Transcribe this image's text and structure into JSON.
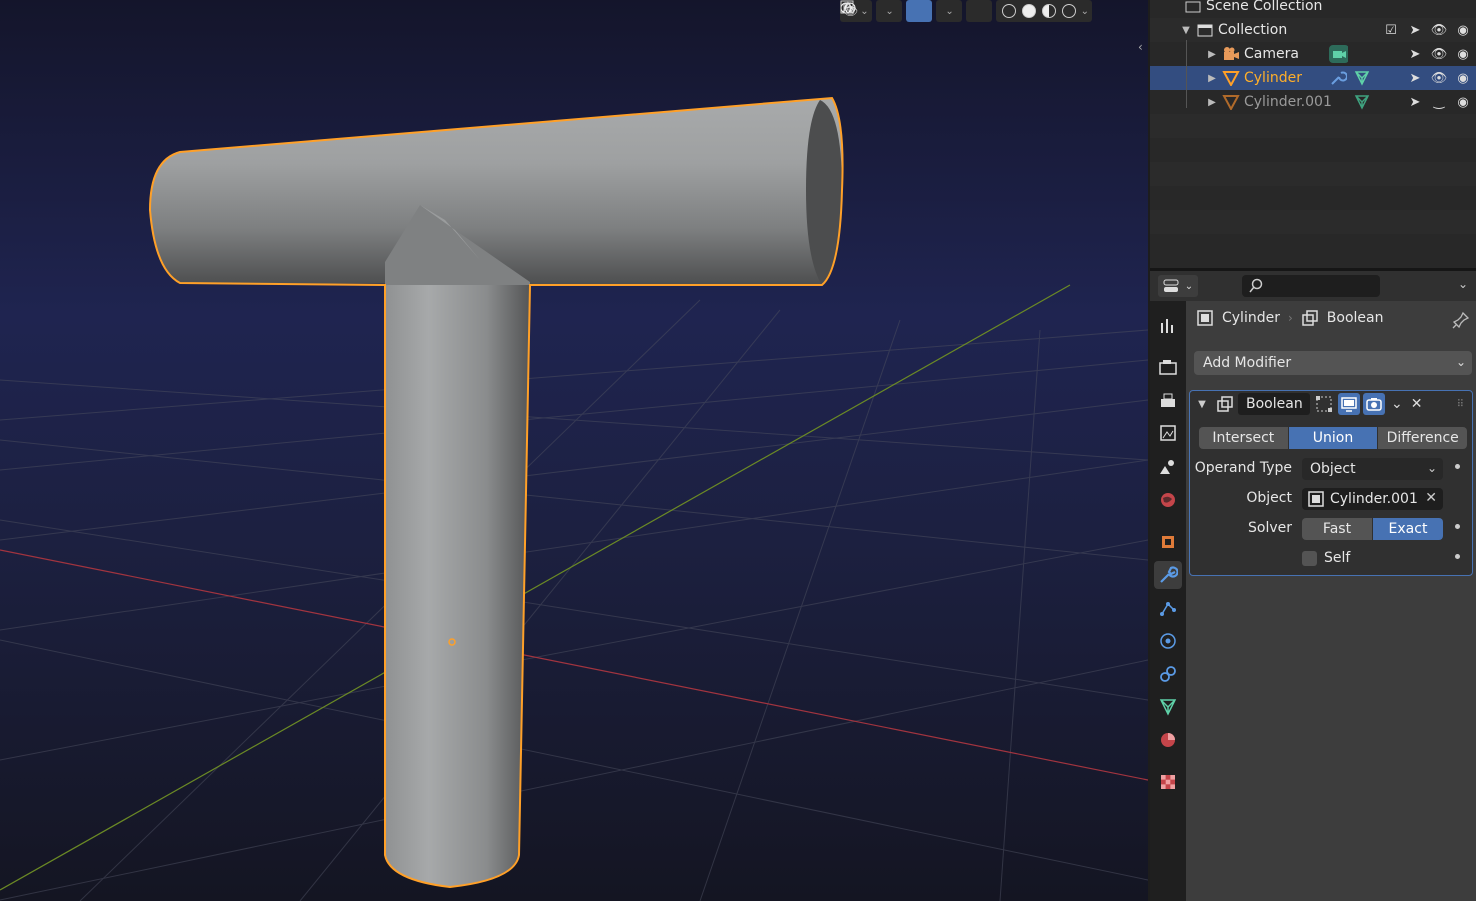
{
  "viewport": {
    "header_icons": [
      "view-object-types-icon",
      "gizmo-icon",
      "overlays-icon",
      "xray-icon",
      "wireframe-shading-icon",
      "solid-shading-icon",
      "material-shading-icon",
      "rendered-shading-icon"
    ]
  },
  "outliner": {
    "rows": [
      {
        "label": "Scene Collection"
      },
      {
        "label": "Collection"
      },
      {
        "label": "Camera"
      },
      {
        "label": "Cylinder"
      },
      {
        "label": "Cylinder.001"
      }
    ]
  },
  "properties": {
    "search_placeholder": "",
    "breadcrumb": {
      "object": "Cylinder",
      "modifier": "Boolean"
    },
    "add_modifier": "Add Modifier",
    "modifier": {
      "name": "Boolean",
      "operations": [
        "Intersect",
        "Union",
        "Difference"
      ],
      "active_operation": "Union",
      "operand_type_label": "Operand Type",
      "operand_type_value": "Object",
      "object_label": "Object",
      "object_value": "Cylinder.001",
      "solver_label": "Solver",
      "solver_options": [
        "Fast",
        "Exact"
      ],
      "active_solver": "Exact",
      "self_label": "Self"
    }
  },
  "colors": {
    "accent": "#4772b3",
    "selected_outline": "#ffa028",
    "active_text": "#ffaf29"
  }
}
